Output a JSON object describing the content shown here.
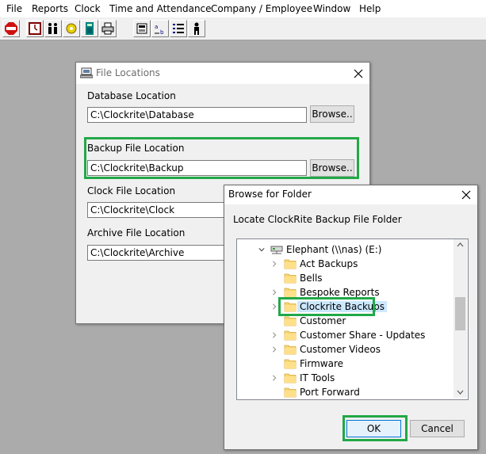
{
  "menu": [
    "File",
    "Reports",
    "Clock",
    "Time and Attendance",
    "Company / Employee",
    "Window",
    "Help"
  ],
  "toolbar_icons": [
    "stop-icon",
    "clock-icon",
    "employees-icon",
    "gear-icon",
    "calculator-icon",
    "printer-icon",
    "backup-icon",
    "sort-icon",
    "list-icon",
    "person-icon"
  ],
  "file_locations": {
    "title": "File Locations",
    "database_label": "Database Location",
    "database_value": "C:\\Clockrite\\Database",
    "backup_label": "Backup File Location",
    "backup_value": "C:\\Clockrite\\Backup",
    "clock_label": "Clock File Location",
    "clock_value": "C:\\Clockrite\\Clock",
    "archive_label": "Archive File Location",
    "archive_value": "C:\\Clockrite\\Archive",
    "browse_label": "Browse.."
  },
  "browse_dialog": {
    "title": "Browse for Folder",
    "instruction": "Locate ClockRite Backup File Folder",
    "root": "Elephant (\\\\nas) (E:)",
    "folders": [
      {
        "name": "Act Backups",
        "expandable": true
      },
      {
        "name": "Bells",
        "expandable": false
      },
      {
        "name": "Bespoke Reports",
        "expandable": true
      },
      {
        "name": "Clockrite Backups",
        "expandable": true,
        "selected": true
      },
      {
        "name": "Customer",
        "expandable": false
      },
      {
        "name": "Customer Share - Updates",
        "expandable": true
      },
      {
        "name": "Customer Videos",
        "expandable": true
      },
      {
        "name": "Firmware",
        "expandable": false
      },
      {
        "name": "IT Tools",
        "expandable": true
      },
      {
        "name": "Port Forward",
        "expandable": false
      }
    ],
    "ok_label": "OK",
    "cancel_label": "Cancel"
  },
  "colors": {
    "highlight": "#22a848",
    "selection": "#cce8ff"
  }
}
